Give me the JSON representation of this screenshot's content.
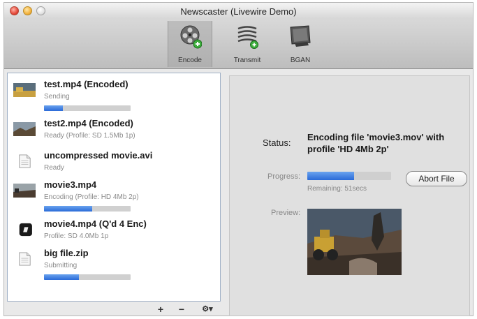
{
  "window": {
    "title": "Newscaster (Livewire Demo)"
  },
  "toolbar": {
    "buttons": [
      {
        "label": "Encode",
        "icon": "film-reel-icon",
        "selected": true
      },
      {
        "label": "Transmit",
        "icon": "transmit-icon",
        "selected": false
      },
      {
        "label": "BGAN",
        "icon": "bgan-terminal-icon",
        "selected": false
      }
    ]
  },
  "queue": {
    "items": [
      {
        "name": "test.mp4 (Encoded)",
        "status": "Sending",
        "progress": 0.22,
        "thumb": "video-thumbnail"
      },
      {
        "name": "test2.mp4 (Encoded)",
        "status": "Ready (Profile: SD 1.5Mb 1p)",
        "progress": null,
        "thumb": "video-thumbnail"
      },
      {
        "name": "uncompressed movie.avi",
        "status": "Ready",
        "progress": null,
        "thumb": "document-icon"
      },
      {
        "name": "movie3.mp4",
        "status": "Encoding (Profile: HD 4Mb 2p)",
        "progress": 0.56,
        "thumb": "video-thumbnail"
      },
      {
        "name": "movie4.mp4 (Q'd 4 Enc)",
        "status": "Profile: SD 4.0Mb 1p",
        "progress": null,
        "thumb": "quicktime-icon"
      },
      {
        "name": "big file.zip",
        "status": "Submitting",
        "progress": 0.4,
        "thumb": "document-icon"
      }
    ],
    "add_label": "+",
    "remove_label": "−",
    "gear_label": "⚙▾"
  },
  "detail": {
    "status_label": "Status:",
    "status_text": "Encoding file 'movie3.mov' with profile 'HD 4Mb 2p'",
    "progress_label": "Progress:",
    "progress": 0.56,
    "remaining_text": "Remaining: 51secs",
    "abort_label": "Abort File",
    "preview_label": "Preview:"
  },
  "colors": {
    "accent": "#2a6ad8",
    "selection_border": "#9fb0c6"
  }
}
